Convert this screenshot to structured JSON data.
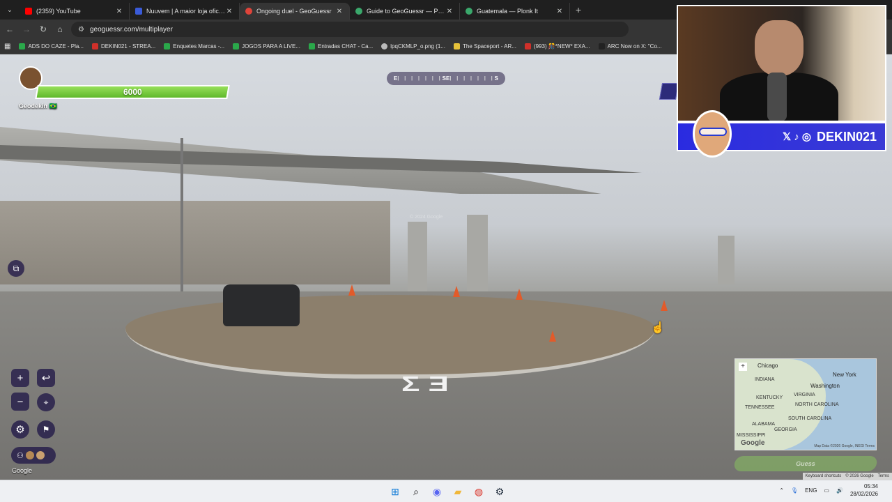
{
  "browser": {
    "tabs": [
      {
        "title": "(2359) YouTube",
        "color": "#ff0000",
        "active": false
      },
      {
        "title": "Nuuvem | A maior loja oficial de",
        "color": "#3a5bd9",
        "active": false
      },
      {
        "title": "Ongoing duel - GeoGuessr",
        "color": "#e0443a",
        "active": true
      },
      {
        "title": "Guide to GeoGuessr — Plonk It",
        "color": "#3aa86b",
        "active": false
      },
      {
        "title": "Guatemala — Plonk It",
        "color": "#3aa86b",
        "active": false
      }
    ],
    "url": "geoguessr.com/multiplayer",
    "bookmarks": [
      {
        "label": "ADS DO CAZE - Pla...",
        "color": "#2aa84a"
      },
      {
        "label": "DEKIN021 - STREA...",
        "color": "#d0302a"
      },
      {
        "label": "Enquetes Marcas -...",
        "color": "#2aa84a"
      },
      {
        "label": "JOGOS PARA A LIVE...",
        "color": "#2aa84a"
      },
      {
        "label": "Entradas CHAT - Ca...",
        "color": "#2aa84a"
      },
      {
        "label": "lpqCKMLP_o.png (1...",
        "color": "#bbbbbb"
      },
      {
        "label": "The Spaceport - AR...",
        "color": "#e6c23a"
      },
      {
        "label": "(993) 🎊*NEW* EXA...",
        "color": "#d0302a"
      },
      {
        "label": "ARC Now on X: \"Co...",
        "color": "#222222"
      }
    ]
  },
  "game": {
    "player_name": "Geodekin",
    "player_flag": "🇧🇷",
    "health": "6000",
    "compass": {
      "left": "E",
      "center": "SE",
      "right": "S",
      "ticks": "| | | | | | |"
    },
    "road_marking": "Σ  Ǝ",
    "watermark": "© 2024 Google",
    "google_label": "Google",
    "guess_label": "Guess",
    "minimap": {
      "labels": [
        "Chicago",
        "INDIANA",
        "New York",
        "Washington",
        "KENTUCKY",
        "VIRGINIA",
        "TENNESSEE",
        "NORTH CAROLINA",
        "SOUTH CAROLINA",
        "GEORGIA",
        "ALABAMA",
        "MISSISSIPPI"
      ],
      "google_word": "Google",
      "credit": "Map Data ©2026 Google, INEGI   Terms"
    },
    "footer_links": [
      "Keyboard shortcuts",
      "© 2026 Google",
      "Terms"
    ]
  },
  "stream": {
    "handle": "DEKIN021",
    "social_icons": "𝕏 ♪ ◎"
  },
  "taskbar": {
    "lang": "ENG",
    "time": "05:34",
    "date": "28/02/2026"
  }
}
